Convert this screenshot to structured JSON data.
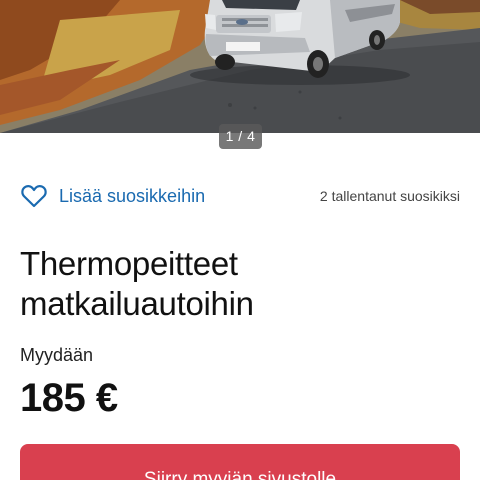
{
  "gallery": {
    "image_alt": "Matkailuauto",
    "indicator": "1 / 4"
  },
  "favorite": {
    "icon": "heart-outline-icon",
    "label": "Lisää suosikkeihin",
    "saved_count_text": "2 tallentanut suosikiksi"
  },
  "listing": {
    "title": "Thermopeitteet matkailuautoihin",
    "sale_type": "Myydään",
    "price": "185 €"
  },
  "cta": {
    "label": "Siirry myyjän sivustolle"
  },
  "colors": {
    "accent_link": "#1a6ab0",
    "cta_background": "#d9404f",
    "text": "#111111"
  }
}
